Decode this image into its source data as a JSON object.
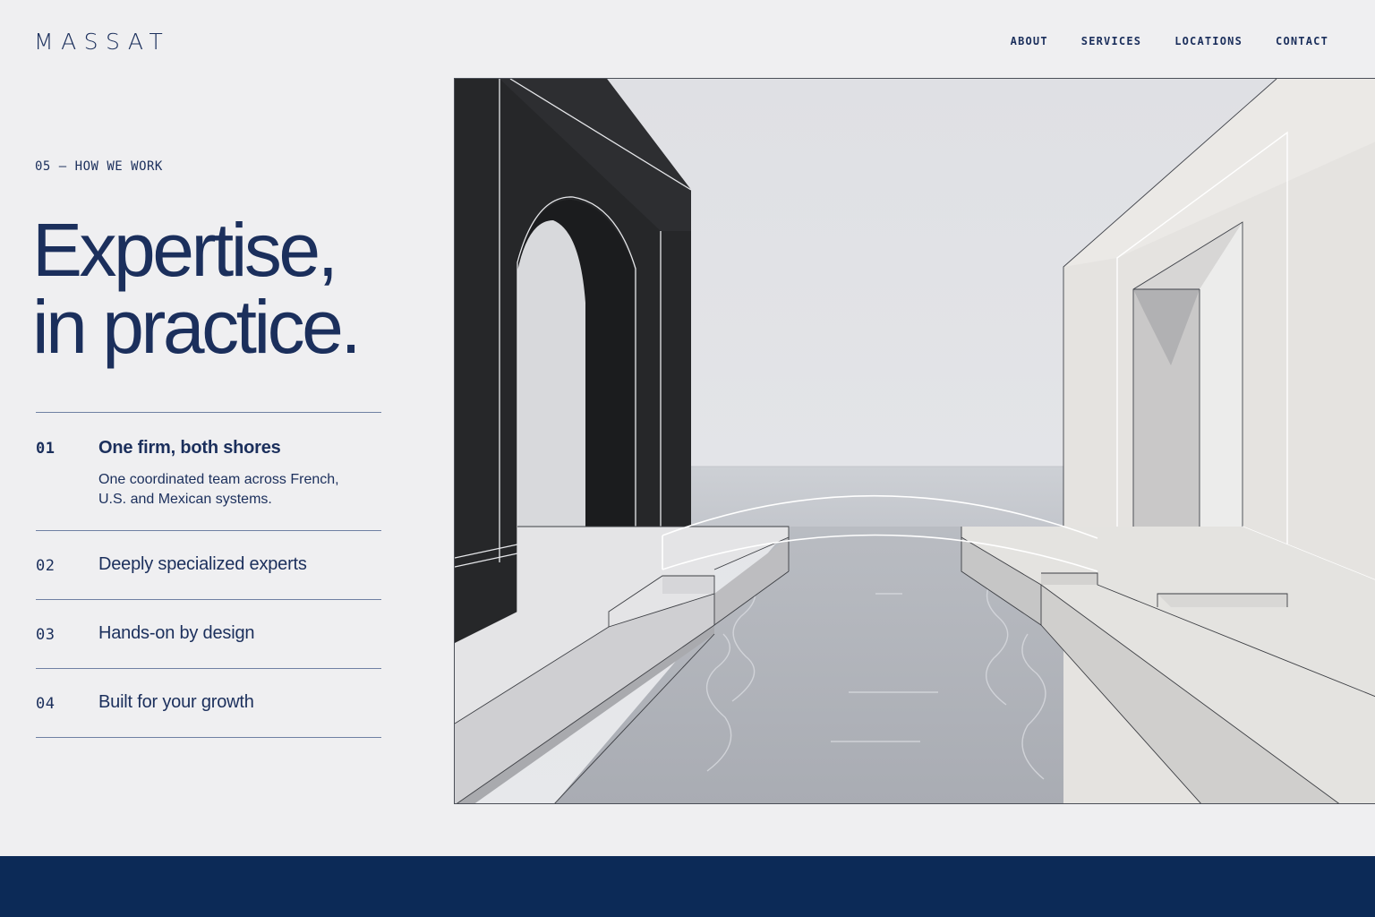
{
  "brand": {
    "logo": "MASSAT"
  },
  "nav": {
    "items": [
      {
        "label": "ABOUT"
      },
      {
        "label": "SERVICES"
      },
      {
        "label": "LOCATIONS"
      },
      {
        "label": "CONTACT"
      }
    ]
  },
  "section": {
    "eyebrow": "05 — HOW WE WORK",
    "headline_line1": "Expertise,",
    "headline_line2": "in practice."
  },
  "principles": [
    {
      "number": "01",
      "title": "One firm, both shores",
      "description": "One coordinated team across French, U.S.  and Mexican systems.",
      "expanded": true
    },
    {
      "number": "02",
      "title": "Deeply specialized experts",
      "expanded": false
    },
    {
      "number": "03",
      "title": "Hands-on by design",
      "expanded": false
    },
    {
      "number": "04",
      "title": "Built for your growth",
      "expanded": false
    }
  ],
  "colors": {
    "navy": "#1b2f5c",
    "footer_band": "#0c2a57",
    "background": "#efeff1",
    "divider": "#6f80a3"
  }
}
